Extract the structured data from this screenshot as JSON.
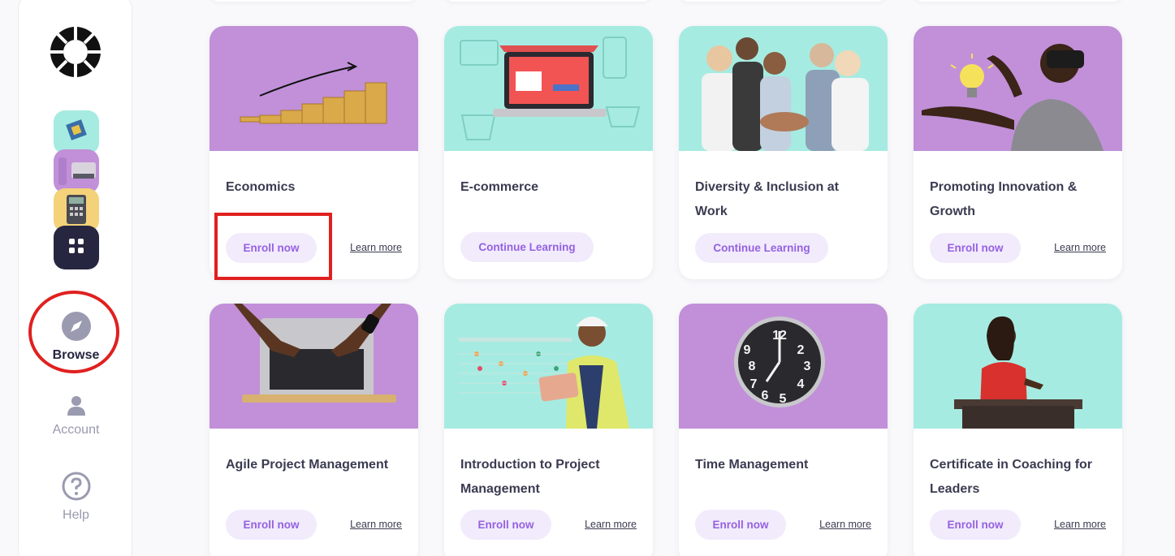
{
  "colors": {
    "purple": "#c190d9",
    "teal": "#a6ebe1",
    "accent_text": "#9561e0",
    "button_bg": "#f1ebfc",
    "sidebar_dark": "#272640",
    "annotation_red": "#e02020"
  },
  "sidebar": {
    "logo_icon": "sunburst-logo",
    "course_thumbs": [
      "circuit-thumb",
      "typewriter-thumb",
      "calculator-thumb"
    ],
    "grid_icon": "grid-icon",
    "nav": [
      {
        "label": "Browse",
        "icon": "compass-icon",
        "active": true
      },
      {
        "label": "Account",
        "icon": "user-icon",
        "active": false
      },
      {
        "label": "Help",
        "icon": "question-icon",
        "active": false
      }
    ]
  },
  "courses": [
    {
      "title": "Economics",
      "button": "Enroll now",
      "learn_more": "Learn more",
      "image": "coin-stacks-image",
      "bg": "purple"
    },
    {
      "title": "E-commerce",
      "button": "Continue Learning",
      "learn_more": "",
      "image": "laptop-shop-image",
      "bg": "teal"
    },
    {
      "title": "Diversity & Inclusion at Work",
      "button": "Continue Learning",
      "learn_more": "",
      "image": "team-hands-image",
      "bg": "teal"
    },
    {
      "title": "Promoting Innovation & Growth",
      "button": "Enroll now",
      "learn_more": "Learn more",
      "image": "vr-headset-image",
      "bg": "purple"
    },
    {
      "title": "Agile Project Management",
      "button": "Enroll now",
      "learn_more": "Learn more",
      "image": "typing-laptop-image",
      "bg": "purple"
    },
    {
      "title": "Introduction to Project Management",
      "button": "Enroll now",
      "learn_more": "Learn more",
      "image": "engineer-tablet-image",
      "bg": "teal"
    },
    {
      "title": "Time Management",
      "button": "Enroll now",
      "learn_more": "Learn more",
      "image": "wall-clock-image",
      "bg": "purple"
    },
    {
      "title": "Certificate in Coaching for Leaders",
      "button": "Enroll now",
      "learn_more": "Learn more",
      "image": "speaker-podium-image",
      "bg": "teal"
    }
  ]
}
